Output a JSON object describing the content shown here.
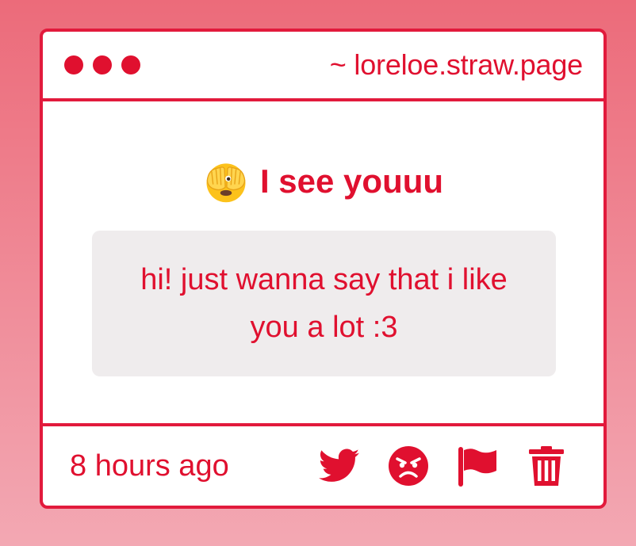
{
  "window": {
    "dots": [
      "dot",
      "dot",
      "dot"
    ],
    "url": "~ loreloe.straw.page"
  },
  "prompt": {
    "icon": "face-with-peeking-eye-emoji",
    "text": "I see youuu"
  },
  "message": {
    "text": "hi! just wanna say that i like you a lot :3"
  },
  "footer": {
    "timestamp": "8 hours ago",
    "actions": [
      {
        "name": "twitter-share",
        "icon": "twitter-bird-icon"
      },
      {
        "name": "angry-react",
        "icon": "angry-face-icon"
      },
      {
        "name": "report",
        "icon": "flag-icon"
      },
      {
        "name": "delete",
        "icon": "trash-icon"
      }
    ]
  },
  "colors": {
    "accent": "#e0102f",
    "border": "#e21a3c",
    "bubble": "#efeced",
    "bg_top": "#ec6b7a",
    "bg_bottom": "#f3a8b3"
  }
}
